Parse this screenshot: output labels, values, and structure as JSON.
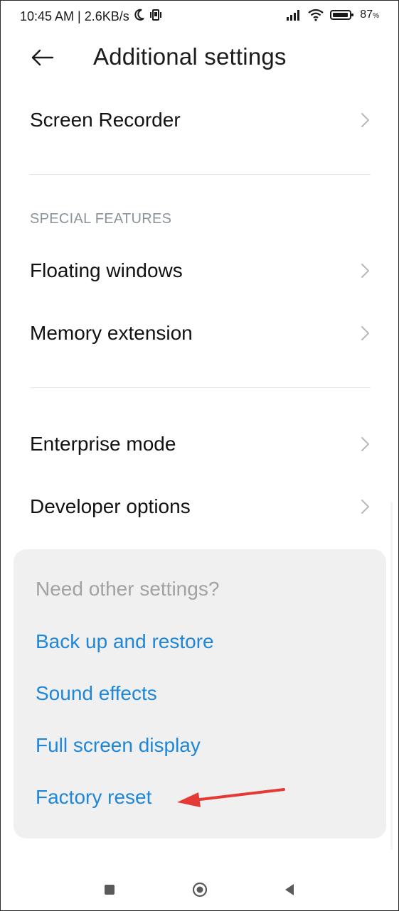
{
  "status_bar": {
    "time_speed": "10:45 AM | 2.6KB/s",
    "battery_percent": "87",
    "battery_unit": "%",
    "icons": [
      "moon-icon",
      "vibrate-icon",
      "signal-icon",
      "wifi-icon",
      "battery-icon"
    ]
  },
  "header": {
    "title": "Additional settings",
    "back_icon": "arrow-left-icon"
  },
  "rows": {
    "screen_recorder": "Screen Recorder",
    "floating_windows": "Floating windows",
    "memory_extension": "Memory extension",
    "enterprise_mode": "Enterprise mode",
    "developer_options": "Developer options"
  },
  "sections": {
    "special_features": "SPECIAL FEATURES"
  },
  "suggestions": {
    "title": "Need other settings?",
    "links": [
      "Back up and restore",
      "Sound effects",
      "Full screen display",
      "Factory reset"
    ]
  },
  "colors": {
    "link": "#1f87d9",
    "annotation": "#e53935",
    "card_bg": "#f0f0f0"
  },
  "navigation": {
    "buttons": [
      "recents-square-icon",
      "home-circle-icon",
      "back-triangle-icon"
    ]
  }
}
